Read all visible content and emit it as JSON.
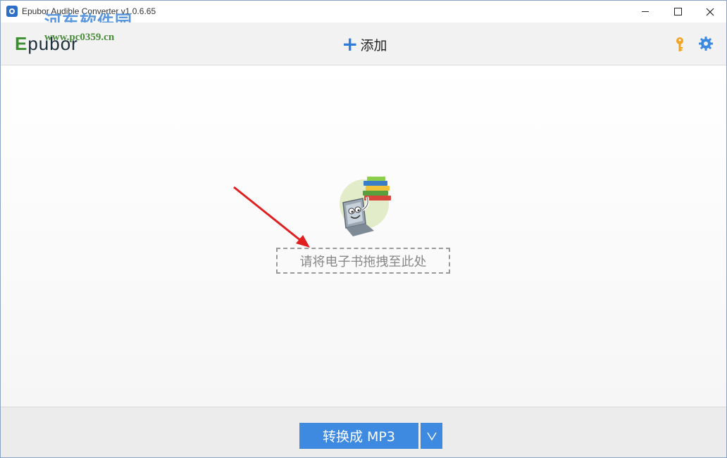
{
  "window": {
    "title": "Epubor Audible Converter v1.0.6.65",
    "minimize": "—",
    "maximize": "☐",
    "close": "✕"
  },
  "watermark": {
    "site_name": "河东软件园",
    "url": "www.pc0359.cn"
  },
  "toolbar": {
    "logo_prefix": "E",
    "logo_rest": "pubor",
    "add_icon": "+",
    "add_label": "添加",
    "icons": [
      "key-icon",
      "gear-icon"
    ],
    "key_color": "#f2a321",
    "gear_color": "#3c8ae0"
  },
  "main": {
    "drop_hint": "请将电子书拖拽至此处",
    "arrow_color": "#e02020"
  },
  "footer": {
    "convert_label": "转换成 MP3",
    "dropdown_icon": "chevron-down-icon",
    "accent": "#3e8ae0"
  }
}
